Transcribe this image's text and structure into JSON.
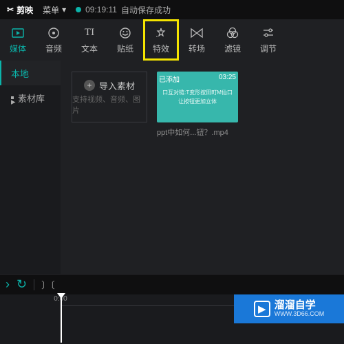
{
  "topbar": {
    "app_name": "剪映",
    "menu_label": "菜单",
    "autosave_time": "09:19:11",
    "autosave_text": "自动保存成功"
  },
  "tabs": [
    {
      "label": "媒体",
      "icon": "play-icon",
      "active": true
    },
    {
      "label": "音频",
      "icon": "disc-icon"
    },
    {
      "label": "文本",
      "icon": "text-icon"
    },
    {
      "label": "贴纸",
      "icon": "sticker-icon"
    },
    {
      "label": "特效",
      "icon": "star-icon",
      "boxed": true
    },
    {
      "label": "转场",
      "icon": "transition-icon"
    },
    {
      "label": "滤镜",
      "icon": "venn-icon"
    },
    {
      "label": "调节",
      "icon": "sliders-icon"
    }
  ],
  "sidebar": {
    "items": [
      "本地",
      "素材库"
    ]
  },
  "import": {
    "label": "导入素材",
    "hint": "支持视频、音频、图片"
  },
  "media": {
    "items": [
      {
        "tag": "已添加",
        "duration": "03:25",
        "line1": "口互对链:T变形按田町M仙口",
        "line2": "让按钮更加立体",
        "filename": "ppt中如何...钮？.mp4"
      }
    ]
  },
  "ruler": {
    "t0": "0:00"
  },
  "logo": {
    "name": "溜溜自学",
    "url": "WWW.3D66.COM"
  }
}
